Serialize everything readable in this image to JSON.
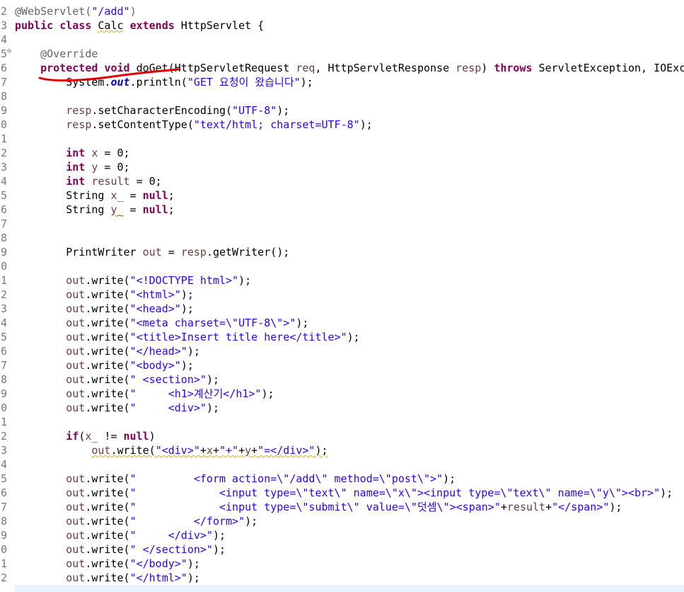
{
  "editor": {
    "lines": [
      {
        "num": "2",
        "code": [
          {
            "t": "@WebServlet(",
            "c": "ann"
          },
          {
            "t": "\"/add\"",
            "c": "str"
          },
          {
            "t": ")",
            "c": "ann"
          }
        ]
      },
      {
        "num": "3",
        "code": [
          {
            "t": "public",
            "c": "kw"
          },
          {
            "t": " "
          },
          {
            "t": "class",
            "c": "kw"
          },
          {
            "t": " "
          },
          {
            "t": "Calc",
            "c": "warn"
          },
          {
            "t": " "
          },
          {
            "t": "extends",
            "c": "kw"
          },
          {
            "t": " HttpServlet {"
          }
        ]
      },
      {
        "num": "4",
        "code": []
      },
      {
        "num": "5",
        "fold": "⊖",
        "code": [
          {
            "t": "    "
          },
          {
            "t": "@Override",
            "c": "ann"
          }
        ]
      },
      {
        "num": "6",
        "code": [
          {
            "t": "    "
          },
          {
            "t": "protected",
            "c": "kw"
          },
          {
            "t": " "
          },
          {
            "t": "void",
            "c": "kw"
          },
          {
            "t": " doGet(HttpServletRequest "
          },
          {
            "t": "req",
            "c": "param"
          },
          {
            "t": ", HttpServletResponse "
          },
          {
            "t": "resp",
            "c": "param"
          },
          {
            "t": ") "
          },
          {
            "t": "throws",
            "c": "kw"
          },
          {
            "t": " ServletException, IOExc"
          }
        ]
      },
      {
        "num": "7",
        "code": [
          {
            "t": "        System."
          },
          {
            "t": "out",
            "c": "fldi"
          },
          {
            "t": ".println("
          },
          {
            "t": "\"GET 요청이 왔습니다\"",
            "c": "str"
          },
          {
            "t": ");"
          }
        ]
      },
      {
        "num": "8",
        "code": []
      },
      {
        "num": "9",
        "code": [
          {
            "t": "        "
          },
          {
            "t": "resp",
            "c": "param"
          },
          {
            "t": ".setCharacterEncoding("
          },
          {
            "t": "\"UTF-8\"",
            "c": "str"
          },
          {
            "t": ");"
          }
        ]
      },
      {
        "num": "0",
        "code": [
          {
            "t": "        "
          },
          {
            "t": "resp",
            "c": "param"
          },
          {
            "t": ".setContentType("
          },
          {
            "t": "\"text/html; charset=UTF-8\"",
            "c": "str"
          },
          {
            "t": ");"
          }
        ]
      },
      {
        "num": "1",
        "code": []
      },
      {
        "num": "2",
        "code": [
          {
            "t": "        "
          },
          {
            "t": "int",
            "c": "kw"
          },
          {
            "t": " "
          },
          {
            "t": "x",
            "c": "param"
          },
          {
            "t": " = 0;"
          }
        ]
      },
      {
        "num": "3",
        "code": [
          {
            "t": "        "
          },
          {
            "t": "int",
            "c": "kw"
          },
          {
            "t": " "
          },
          {
            "t": "y",
            "c": "param"
          },
          {
            "t": " = 0;"
          }
        ]
      },
      {
        "num": "4",
        "code": [
          {
            "t": "        "
          },
          {
            "t": "int",
            "c": "kw"
          },
          {
            "t": " "
          },
          {
            "t": "result",
            "c": "param"
          },
          {
            "t": " = 0;"
          }
        ]
      },
      {
        "num": "5",
        "code": [
          {
            "t": "        String "
          },
          {
            "t": "x_",
            "c": "param"
          },
          {
            "t": " = "
          },
          {
            "t": "null",
            "c": "kw"
          },
          {
            "t": ";"
          }
        ]
      },
      {
        "num": "6",
        "code": [
          {
            "t": "        String "
          },
          {
            "t": "y_",
            "c": "param warn"
          },
          {
            "t": " = "
          },
          {
            "t": "null",
            "c": "kw"
          },
          {
            "t": ";"
          }
        ]
      },
      {
        "num": "7",
        "code": []
      },
      {
        "num": "8",
        "code": []
      },
      {
        "num": "9",
        "code": [
          {
            "t": "        PrintWriter "
          },
          {
            "t": "out",
            "c": "param"
          },
          {
            "t": " = "
          },
          {
            "t": "resp",
            "c": "param"
          },
          {
            "t": ".getWriter();"
          }
        ]
      },
      {
        "num": "0",
        "code": []
      },
      {
        "num": "1",
        "code": [
          {
            "t": "        "
          },
          {
            "t": "out",
            "c": "param"
          },
          {
            "t": ".write("
          },
          {
            "t": "\"<!DOCTYPE html>\"",
            "c": "str"
          },
          {
            "t": ");"
          }
        ]
      },
      {
        "num": "2",
        "code": [
          {
            "t": "        "
          },
          {
            "t": "out",
            "c": "param"
          },
          {
            "t": ".write("
          },
          {
            "t": "\"<html>\"",
            "c": "str"
          },
          {
            "t": ");"
          }
        ]
      },
      {
        "num": "3",
        "code": [
          {
            "t": "        "
          },
          {
            "t": "out",
            "c": "param"
          },
          {
            "t": ".write("
          },
          {
            "t": "\"<head>\"",
            "c": "str"
          },
          {
            "t": ");"
          }
        ]
      },
      {
        "num": "4",
        "code": [
          {
            "t": "        "
          },
          {
            "t": "out",
            "c": "param"
          },
          {
            "t": ".write("
          },
          {
            "t": "\"<meta charset=\\\"UTF-8\\\">\"",
            "c": "str"
          },
          {
            "t": ");"
          }
        ]
      },
      {
        "num": "5",
        "code": [
          {
            "t": "        "
          },
          {
            "t": "out",
            "c": "param"
          },
          {
            "t": ".write("
          },
          {
            "t": "\"<title>Insert title here</title>\"",
            "c": "str"
          },
          {
            "t": ");"
          }
        ]
      },
      {
        "num": "6",
        "code": [
          {
            "t": "        "
          },
          {
            "t": "out",
            "c": "param"
          },
          {
            "t": ".write("
          },
          {
            "t": "\"</head>\"",
            "c": "str"
          },
          {
            "t": ");"
          }
        ]
      },
      {
        "num": "7",
        "code": [
          {
            "t": "        "
          },
          {
            "t": "out",
            "c": "param"
          },
          {
            "t": ".write("
          },
          {
            "t": "\"<body>\"",
            "c": "str"
          },
          {
            "t": ");"
          }
        ]
      },
      {
        "num": "8",
        "code": [
          {
            "t": "        "
          },
          {
            "t": "out",
            "c": "param"
          },
          {
            "t": ".write("
          },
          {
            "t": "\" <section>\"",
            "c": "str"
          },
          {
            "t": ");"
          }
        ]
      },
      {
        "num": "9",
        "code": [
          {
            "t": "        "
          },
          {
            "t": "out",
            "c": "param"
          },
          {
            "t": ".write("
          },
          {
            "t": "\"     <h1>계산기</h1>\"",
            "c": "str"
          },
          {
            "t": ");"
          }
        ]
      },
      {
        "num": "0",
        "code": [
          {
            "t": "        "
          },
          {
            "t": "out",
            "c": "param"
          },
          {
            "t": ".write("
          },
          {
            "t": "\"     <div>\"",
            "c": "str"
          },
          {
            "t": ");"
          }
        ]
      },
      {
        "num": "1",
        "code": []
      },
      {
        "num": "2",
        "code": [
          {
            "t": "        "
          },
          {
            "t": "if",
            "c": "kw"
          },
          {
            "t": "("
          },
          {
            "t": "x_",
            "c": "param"
          },
          {
            "t": " != "
          },
          {
            "t": "null",
            "c": "kw"
          },
          {
            "t": ")"
          }
        ]
      },
      {
        "num": "3",
        "code": [
          {
            "t": "            "
          },
          {
            "t": "out",
            "c": "param warn"
          },
          {
            "t": ".write(",
            "c": "warn"
          },
          {
            "t": "\"<div>\"",
            "c": "str warn"
          },
          {
            "t": "+",
            "c": "warn"
          },
          {
            "t": "x",
            "c": "param warn"
          },
          {
            "t": "+",
            "c": "warn"
          },
          {
            "t": "\"+\"",
            "c": "str warn"
          },
          {
            "t": "+",
            "c": "warn"
          },
          {
            "t": "y",
            "c": "param warn"
          },
          {
            "t": "+",
            "c": "warn"
          },
          {
            "t": "\"=</div>\"",
            "c": "str warn"
          },
          {
            "t": ");",
            "c": "warn"
          }
        ]
      },
      {
        "num": "4",
        "code": []
      },
      {
        "num": "5",
        "code": [
          {
            "t": "        "
          },
          {
            "t": "out",
            "c": "param"
          },
          {
            "t": ".write("
          },
          {
            "t": "\"         <form action=\\\"/add\\\" method=\\\"post\\\">\"",
            "c": "str"
          },
          {
            "t": ");"
          }
        ]
      },
      {
        "num": "6",
        "code": [
          {
            "t": "        "
          },
          {
            "t": "out",
            "c": "param"
          },
          {
            "t": ".write("
          },
          {
            "t": "\"             <input type=\\\"text\\\" name=\\\"x\\\"><input type=\\\"text\\\" name=\\\"y\\\"><br>\"",
            "c": "str"
          },
          {
            "t": ");"
          }
        ]
      },
      {
        "num": "7",
        "code": [
          {
            "t": "        "
          },
          {
            "t": "out",
            "c": "param"
          },
          {
            "t": ".write("
          },
          {
            "t": "\"             <input type=\\\"submit\\\" value=\\\"덧셈\\\"><span>\"",
            "c": "str"
          },
          {
            "t": "+"
          },
          {
            "t": "result",
            "c": "param"
          },
          {
            "t": "+"
          },
          {
            "t": "\"</span>\"",
            "c": "str"
          },
          {
            "t": ");"
          }
        ]
      },
      {
        "num": "8",
        "code": [
          {
            "t": "        "
          },
          {
            "t": "out",
            "c": "param"
          },
          {
            "t": ".write("
          },
          {
            "t": "\"         </form>\"",
            "c": "str"
          },
          {
            "t": ");"
          }
        ]
      },
      {
        "num": "9",
        "code": [
          {
            "t": "        "
          },
          {
            "t": "out",
            "c": "param"
          },
          {
            "t": ".write("
          },
          {
            "t": "\"     </div>\"",
            "c": "str"
          },
          {
            "t": ");"
          }
        ]
      },
      {
        "num": "0",
        "code": [
          {
            "t": "        "
          },
          {
            "t": "out",
            "c": "param"
          },
          {
            "t": ".write("
          },
          {
            "t": "\" </section>\"",
            "c": "str"
          },
          {
            "t": ");"
          }
        ]
      },
      {
        "num": "1",
        "code": [
          {
            "t": "        "
          },
          {
            "t": "out",
            "c": "param"
          },
          {
            "t": ".write("
          },
          {
            "t": "\"</body>\"",
            "c": "str"
          },
          {
            "t": ");"
          }
        ]
      },
      {
        "num": "2",
        "code": [
          {
            "t": "        "
          },
          {
            "t": "out",
            "c": "param"
          },
          {
            "t": ".write("
          },
          {
            "t": "\"</html>\"",
            "c": "str"
          },
          {
            "t": ");"
          }
        ]
      }
    ]
  },
  "colors": {
    "keyword": "#7f0055",
    "string": "#2a00ff",
    "annotation": "#646464",
    "variable": "#6a3e3e",
    "static_field": "#0000c0",
    "line_number": "#787878",
    "annotation_mark": "#e00000"
  }
}
